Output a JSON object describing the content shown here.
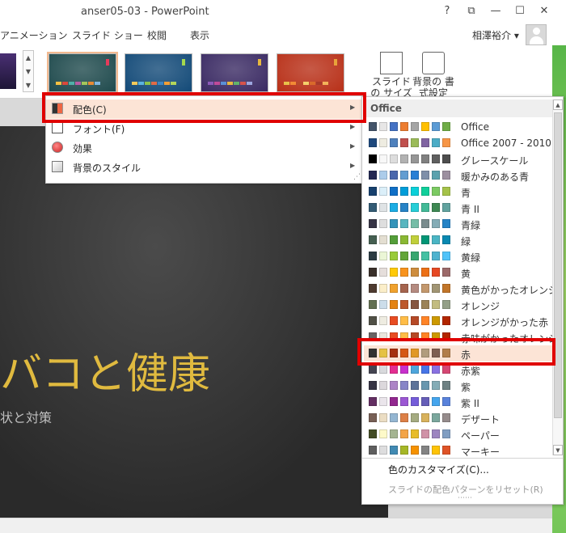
{
  "window": {
    "title": "anser05-03 - PowerPoint",
    "help": "?",
    "restore_ribbon": "⧉",
    "minimize": "—",
    "maximize": "☐",
    "close": "✕"
  },
  "tabs": [
    "アニメーション",
    "スライド ショー",
    "校閲",
    "表示"
  ],
  "user": {
    "name": "相澤裕介",
    "dropdown": "▾",
    "icon": "avatar-icon"
  },
  "ribbon": {
    "scroll_up": "▲",
    "scroll_down": "▼",
    "scroll_more": "▼",
    "slide_size_label": "スライドの サイズ",
    "background_format_label": "背景の 書式設定"
  },
  "theme_variants": [
    {
      "bg": "#1f4a4d",
      "tag": "#e63b5a",
      "bars": [
        "#f5c142",
        "#d9483b",
        "#50b0a8",
        "#b85ea4",
        "#a4c65a",
        "#e88a35",
        "#7fb6e0"
      ]
    },
    {
      "bg": "#134a78",
      "tag": "#a4d94d",
      "bars": [
        "#f2c95a",
        "#5ab3e0",
        "#8bc34a",
        "#e06b47",
        "#3b86c5",
        "#f29f35",
        "#b3d65a"
      ]
    },
    {
      "bg": "#3a2a63",
      "tag": "#e8b83e",
      "bars": [
        "#8b5ab8",
        "#c04a9a",
        "#5a8fd6",
        "#e8b83e",
        "#62b36a",
        "#d6534b",
        "#9da6df"
      ]
    },
    {
      "bg": "#b83018",
      "tag": "#e8a33a",
      "bars": [
        "#e8c14a",
        "#f28a35",
        "#b84a2b",
        "#f4d06a",
        "#d96a2b",
        "#a83a2a",
        "#f2b25a"
      ]
    }
  ],
  "menu": {
    "items": [
      {
        "label": "配色(C)",
        "icon": "color-scheme-icon"
      },
      {
        "label": "フォント(F)",
        "icon": "font-icon"
      },
      {
        "label": "効果",
        "icon": "effects-icon"
      },
      {
        "label": "背景のスタイル",
        "icon": "background-style-icon"
      }
    ],
    "arrow": "▶",
    "grip": "⋰"
  },
  "submenu": {
    "header": "Office",
    "schemes": [
      {
        "name": "Office",
        "colors": [
          "#44546a",
          "#e7e6e6",
          "#4472c4",
          "#ed7d31",
          "#a5a5a5",
          "#ffc000",
          "#5b9bd5",
          "#70ad47"
        ]
      },
      {
        "name": "Office 2007 - 2010",
        "colors": [
          "#1f497d",
          "#eeece1",
          "#4f81bd",
          "#c0504d",
          "#9bbb59",
          "#8064a2",
          "#4bacc6",
          "#f79646"
        ]
      },
      {
        "name": "グレースケール",
        "colors": [
          "#000000",
          "#f8f8f8",
          "#dddddd",
          "#b2b2b2",
          "#969696",
          "#808080",
          "#5f5f5f",
          "#4d4d4d"
        ]
      },
      {
        "name": "暖かみのある青",
        "colors": [
          "#242852",
          "#acccea",
          "#4a66ac",
          "#629dd1",
          "#297fd5",
          "#7f8fa9",
          "#5aa2ae",
          "#9d90a0"
        ]
      },
      {
        "name": "青",
        "colors": [
          "#17406d",
          "#dbeff9",
          "#0f6fc6",
          "#009dd9",
          "#0bd0d9",
          "#10cf9b",
          "#7cca62",
          "#a5c249"
        ]
      },
      {
        "name": "青 II",
        "colors": [
          "#335b74",
          "#dfe3e5",
          "#1cade4",
          "#2683c6",
          "#27ced7",
          "#42ba97",
          "#3e8853",
          "#62a39f"
        ]
      },
      {
        "name": "青緑",
        "colors": [
          "#373545",
          "#dedede",
          "#3494ba",
          "#58b6c0",
          "#75bda7",
          "#7a8c8e",
          "#84acb6",
          "#2683c6"
        ]
      },
      {
        "name": "緑",
        "colors": [
          "#455f51",
          "#e3ded1",
          "#549e39",
          "#8ab833",
          "#c0cf3a",
          "#029676",
          "#4ab5c4",
          "#0989b1"
        ]
      },
      {
        "name": "黄緑",
        "colors": [
          "#2c3c43",
          "#ebf6d6",
          "#99cb38",
          "#63a537",
          "#37a76f",
          "#44c1a3",
          "#4eb3cf",
          "#51c3f9"
        ]
      },
      {
        "name": "黄",
        "colors": [
          "#39302a",
          "#e5dedb",
          "#ffca08",
          "#f8931d",
          "#ce8d3e",
          "#ec7016",
          "#e64823",
          "#9c6a6a"
        ]
      },
      {
        "name": "黄色がかったオレンジ",
        "colors": [
          "#4e3b30",
          "#fbeec9",
          "#f0a22e",
          "#a5644e",
          "#b58b80",
          "#c3986d",
          "#a19574",
          "#c17529"
        ]
      },
      {
        "name": "オレンジ",
        "colors": [
          "#637052",
          "#ccddea",
          "#e48312",
          "#bd582c",
          "#865640",
          "#9b8357",
          "#c2bc80",
          "#94a088"
        ]
      },
      {
        "name": "オレンジがかった赤",
        "colors": [
          "#505046",
          "#eeece1",
          "#e84c22",
          "#ffbd47",
          "#b64926",
          "#ff8427",
          "#cc9900",
          "#b22600"
        ]
      },
      {
        "name": "赤味がかったオレンジ",
        "colors": [
          "#696464",
          "#e9e5dc",
          "#e84c22",
          "#ffbd47",
          "#b64926",
          "#ff8427",
          "#cc9900",
          "#b22600"
        ]
      },
      {
        "name": "赤",
        "colors": [
          "#323232",
          "#e5c243",
          "#a5300f",
          "#d55816",
          "#e19825",
          "#b19c7d",
          "#7f5f52",
          "#b27d49"
        ]
      },
      {
        "name": "赤紫",
        "colors": [
          "#454551",
          "#d8d9dc",
          "#e32d91",
          "#c830cc",
          "#4ea6dc",
          "#4775e7",
          "#8971e1",
          "#d54773"
        ]
      },
      {
        "name": "紫",
        "colors": [
          "#373545",
          "#dcd8dc",
          "#ad84c6",
          "#8784c7",
          "#5d739a",
          "#6997af",
          "#84acb6",
          "#6f8183"
        ]
      },
      {
        "name": "紫 II",
        "colors": [
          "#632e62",
          "#eae5eb",
          "#92278f",
          "#9b57d3",
          "#755dd9",
          "#665eb8",
          "#45a5ed",
          "#5982db"
        ]
      },
      {
        "name": "デザート",
        "colors": [
          "#775f55",
          "#ebddc3",
          "#94b6d2",
          "#dd8047",
          "#a5ab81",
          "#d8b25c",
          "#7ba79d",
          "#968c8c"
        ]
      },
      {
        "name": "ペーパー",
        "colors": [
          "#444d26",
          "#fefac9",
          "#a5b592",
          "#f3a447",
          "#e7bc29",
          "#d092a7",
          "#9c85c0",
          "#809ec2"
        ]
      },
      {
        "name": "マーキー",
        "colors": [
          "#5e5e5e",
          "#ddddde",
          "#418ab3",
          "#a6b727",
          "#f69200",
          "#838383",
          "#fec306",
          "#df5327"
        ]
      }
    ],
    "customize": "色のカスタマイズ(C)...",
    "reset": "スライドの配色パターンをリセット(R)",
    "dots": "⋯⋯",
    "scroll_up": "▲",
    "scroll_down": "▼"
  },
  "slide": {
    "title": "バコと健康",
    "subtitle": "状と対策"
  }
}
